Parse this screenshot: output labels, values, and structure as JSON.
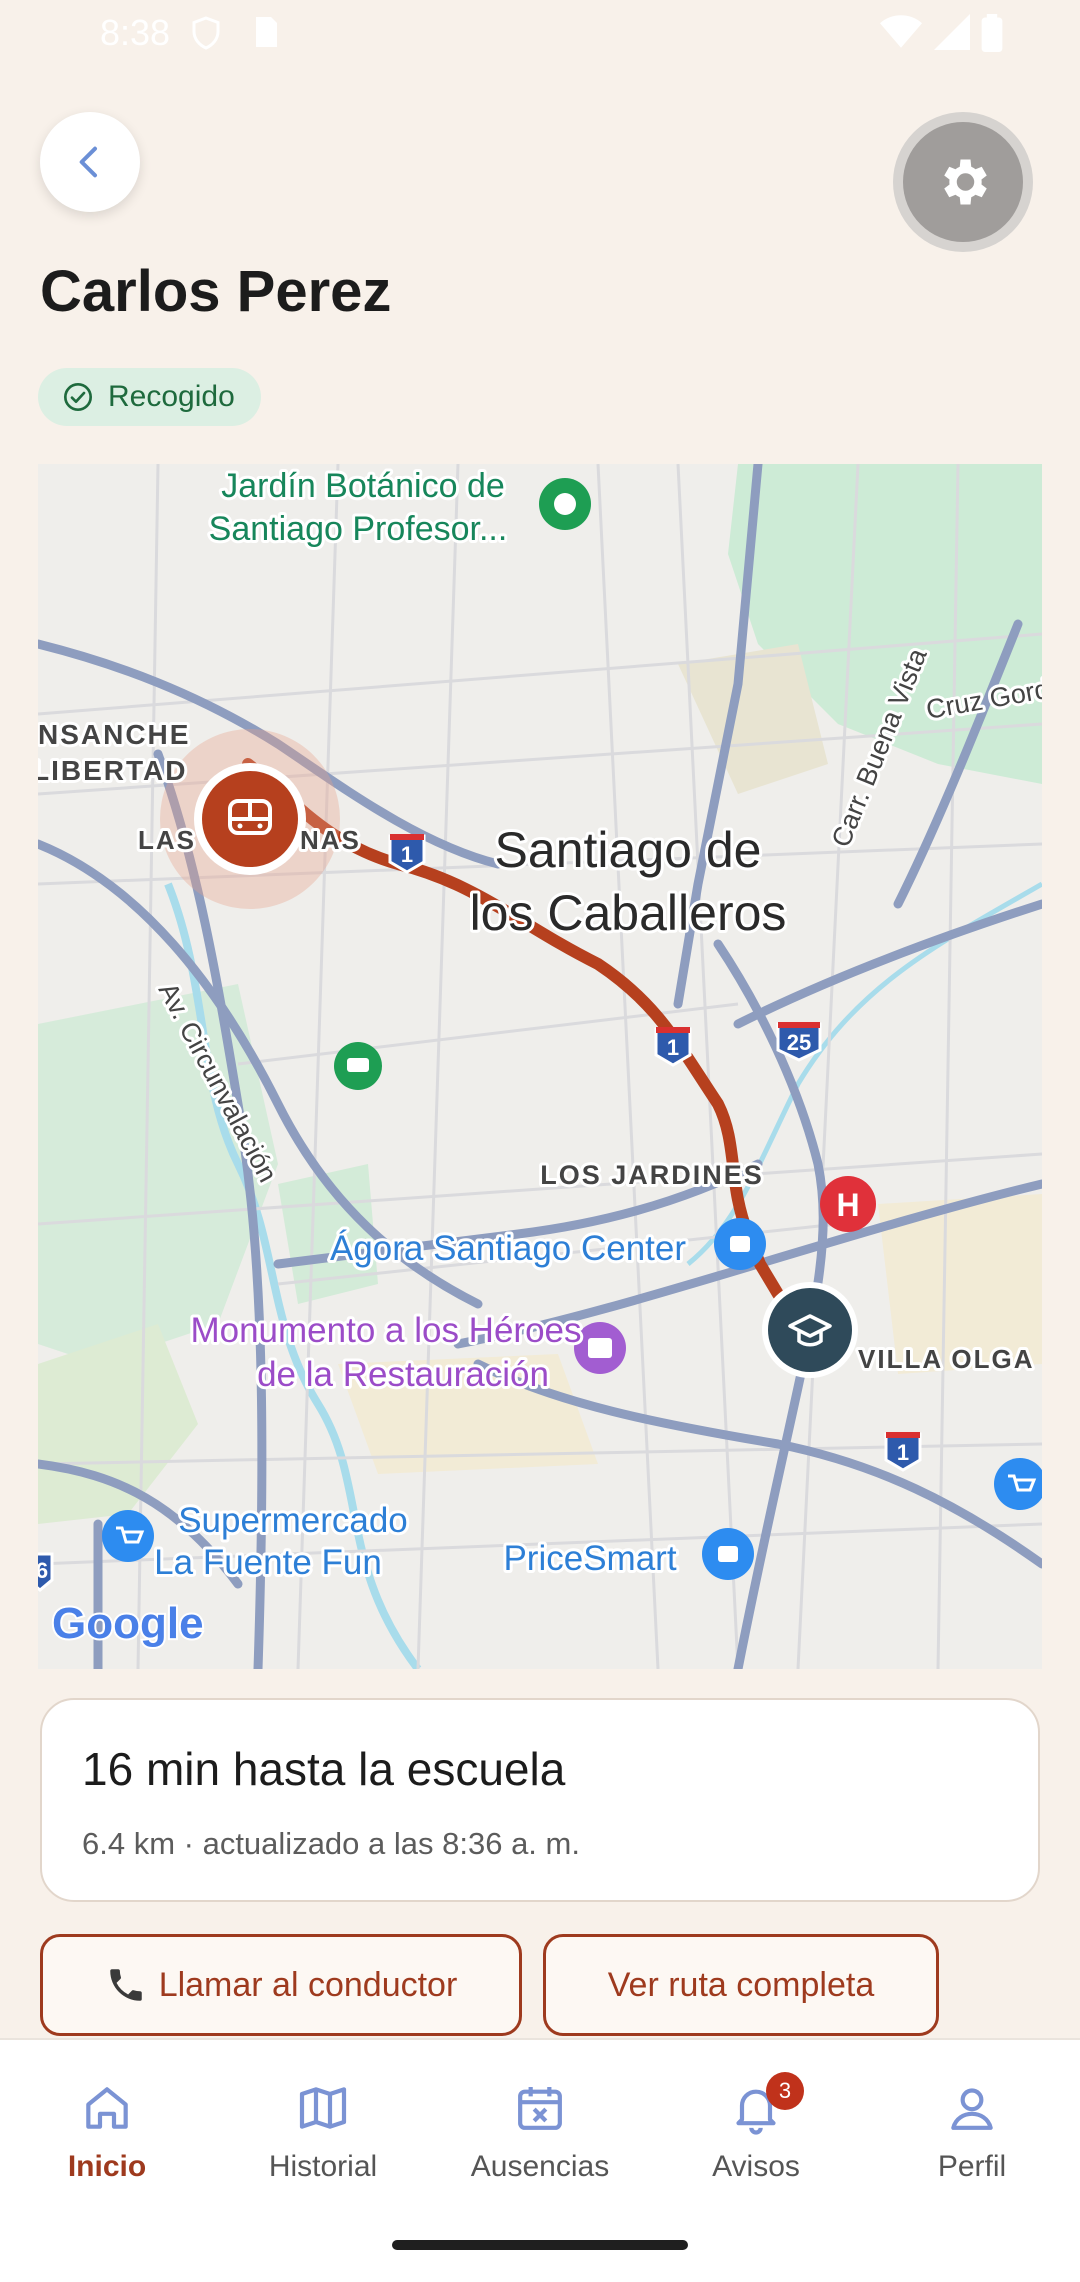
{
  "status_bar": {
    "time": "8:38"
  },
  "header": {
    "title": "Carlos Perez",
    "status_badge": "Recogido"
  },
  "map": {
    "attribution": "Google",
    "labels": {
      "garden": "Jardín Botánico de",
      "garden2": "Santiago Profesor...",
      "ensanche": "NSANCHE",
      "libertad": "LIBERTAD",
      "las": "LAS",
      "nas": "NAS",
      "city1": "Santiago de",
      "city2": "los Caballeros",
      "circunv": "Av. Circunvalación",
      "buena_vista": "Carr. Buena Vista",
      "cruz": "Cruz Gord",
      "jardines": "LOS JARDINES",
      "agora": "Ágora Santiago Center",
      "monumento1": "Monumento a los Héroes",
      "monumento2": "de la Restauración",
      "villa_olga": "VILLA OLGA",
      "super1": "Supermercado",
      "super2": "La Fuente Fun",
      "pricesmart": "PriceSmart"
    },
    "shields": {
      "hw1": "1",
      "hw25": "25",
      "hw6": "6"
    }
  },
  "eta": {
    "title": "16 min hasta la escuela",
    "subtitle": "6.4 km · actualizado a las 8:36 a. m."
  },
  "actions": {
    "call_label": "Llamar al conductor",
    "route_label": "Ver ruta completa"
  },
  "nav": {
    "items": [
      {
        "label": "Inicio"
      },
      {
        "label": "Historial"
      },
      {
        "label": "Ausencias"
      },
      {
        "label": "Avisos",
        "badge": "3"
      },
      {
        "label": "Perfil"
      }
    ]
  },
  "colors": {
    "accent": "#9E3A1E",
    "background": "#F8F1EA",
    "badge_bg": "#DCEFE3",
    "badge_text": "#1E6A3D"
  }
}
